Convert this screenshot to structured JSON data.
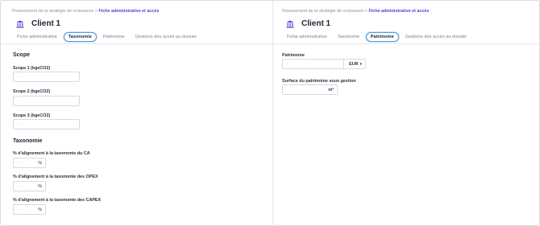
{
  "left": {
    "breadcrumb": {
      "parent": "Financement de la stratégie de croissance",
      "separator": ">",
      "current": "Fiche administrative et accès"
    },
    "title": "Client 1",
    "tabs": [
      "Fiche administrative",
      "Taxonomie",
      "Patrimoine",
      "Gestions des accès au dossier"
    ],
    "active_tab": "Taxonomie",
    "scope": {
      "section_title": "Scope",
      "fields": [
        {
          "label": "Scope 1 (kgeCO2)",
          "value": "-"
        },
        {
          "label": "Scope 2 (kgeCO2)",
          "value": "-"
        },
        {
          "label": "Scope 3 (kgeCO2)",
          "value": "-"
        }
      ]
    },
    "taxonomie": {
      "section_title": "Taxonomie",
      "fields": [
        {
          "label": "% d'alignement à la taxonomie du CA",
          "value": "-",
          "unit": "%"
        },
        {
          "label": "% d'alignement à la taxonomie des OPEX",
          "value": "-",
          "unit": "%"
        },
        {
          "label": "% d'alignement à la taxonomie des CAPEX",
          "value": "-",
          "unit": "%"
        }
      ]
    }
  },
  "right": {
    "breadcrumb": {
      "parent": "Financement de la stratégie de croissance",
      "separator": ">",
      "current": "Fiche administrative et accès"
    },
    "title": "Client 1",
    "tabs": [
      "Fiche administrative",
      "Taxonomie",
      "Patrimoine",
      "Gestions des accès au dossier"
    ],
    "active_tab": "Patrimoine",
    "patrimoine": {
      "label": "Patrimoine",
      "value": "-",
      "currency": "EUR",
      "chevron": "▾"
    },
    "surface": {
      "label": "Surface du patrimoine sous gestion",
      "value": "",
      "unit": "m²"
    }
  },
  "colors": {
    "accent": "#4e3fd6",
    "tab_active_border": "#4b9fe5",
    "text": "#1f2433",
    "muted": "#8a8fa0",
    "border": "#d6d9e0"
  },
  "icons": {
    "title_icon": "bank-icon"
  }
}
